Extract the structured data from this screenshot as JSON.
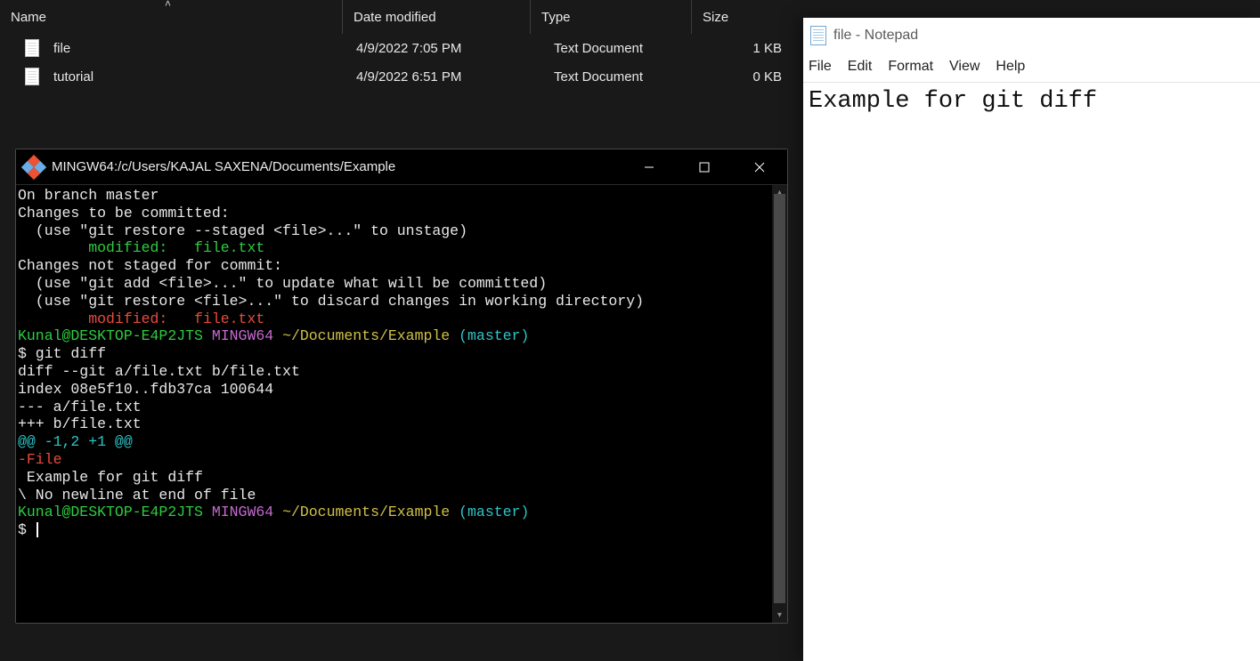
{
  "explorer": {
    "columns": {
      "name": "Name",
      "date": "Date modified",
      "type": "Type",
      "size": "Size"
    },
    "sort_indicator": "˄",
    "rows": [
      {
        "name": "file",
        "date": "4/9/2022 7:05 PM",
        "type": "Text Document",
        "size": "1 KB"
      },
      {
        "name": "tutorial",
        "date": "4/9/2022 6:51 PM",
        "type": "Text Document",
        "size": "0 KB"
      }
    ]
  },
  "terminal": {
    "title": "MINGW64:/c/Users/KAJAL SAXENA/Documents/Example",
    "lines": [
      {
        "segments": [
          {
            "t": "On branch master",
            "c": "wht"
          }
        ]
      },
      {
        "segments": [
          {
            "t": "Changes to be committed:",
            "c": "wht"
          }
        ]
      },
      {
        "segments": [
          {
            "t": "  (use \"git restore --staged <file>...\" to unstage)",
            "c": "wht"
          }
        ]
      },
      {
        "segments": [
          {
            "t": "        ",
            "c": "wht"
          },
          {
            "t": "modified:   file.txt",
            "c": "grn"
          }
        ]
      },
      {
        "segments": [
          {
            "t": "",
            "c": "wht"
          }
        ]
      },
      {
        "segments": [
          {
            "t": "Changes not staged for commit:",
            "c": "wht"
          }
        ]
      },
      {
        "segments": [
          {
            "t": "  (use \"git add <file>...\" to update what will be committed)",
            "c": "wht"
          }
        ]
      },
      {
        "segments": [
          {
            "t": "  (use \"git restore <file>...\" to discard changes in working directory)",
            "c": "wht"
          }
        ]
      },
      {
        "segments": [
          {
            "t": "        ",
            "c": "wht"
          },
          {
            "t": "modified:   file.txt",
            "c": "red"
          }
        ]
      },
      {
        "segments": [
          {
            "t": "",
            "c": "wht"
          }
        ]
      },
      {
        "segments": [
          {
            "t": "",
            "c": "wht"
          }
        ]
      },
      {
        "segments": [
          {
            "t": "Kunal@DESKTOP-E4P2JTS",
            "c": "grn"
          },
          {
            "t": " ",
            "c": "wht"
          },
          {
            "t": "MINGW64",
            "c": "mag"
          },
          {
            "t": " ",
            "c": "wht"
          },
          {
            "t": "~/Documents/Example",
            "c": "yel"
          },
          {
            "t": " ",
            "c": "wht"
          },
          {
            "t": "(master)",
            "c": "cyn"
          }
        ]
      },
      {
        "segments": [
          {
            "t": "$ git diff",
            "c": "wht"
          }
        ]
      },
      {
        "segments": [
          {
            "t": "diff --git a/file.txt b/file.txt",
            "c": "wht"
          }
        ]
      },
      {
        "segments": [
          {
            "t": "index 08e5f10..fdb37ca 100644",
            "c": "wht"
          }
        ]
      },
      {
        "segments": [
          {
            "t": "--- a/file.txt",
            "c": "wht"
          }
        ]
      },
      {
        "segments": [
          {
            "t": "+++ b/file.txt",
            "c": "wht"
          }
        ]
      },
      {
        "segments": [
          {
            "t": "@@ -1,2 +1 @@",
            "c": "cyn"
          }
        ]
      },
      {
        "segments": [
          {
            "t": "-File",
            "c": "red"
          }
        ]
      },
      {
        "segments": [
          {
            "t": " Example for git diff",
            "c": "wht"
          }
        ]
      },
      {
        "segments": [
          {
            "t": "\\ No newline at end of file",
            "c": "wht"
          }
        ]
      },
      {
        "segments": [
          {
            "t": "",
            "c": "wht"
          }
        ]
      },
      {
        "segments": [
          {
            "t": "Kunal@DESKTOP-E4P2JTS",
            "c": "grn"
          },
          {
            "t": " ",
            "c": "wht"
          },
          {
            "t": "MINGW64",
            "c": "mag"
          },
          {
            "t": " ",
            "c": "wht"
          },
          {
            "t": "~/Documents/Example",
            "c": "yel"
          },
          {
            "t": " ",
            "c": "wht"
          },
          {
            "t": "(master)",
            "c": "cyn"
          }
        ]
      },
      {
        "segments": [
          {
            "t": "$ ",
            "c": "wht"
          }
        ],
        "cursor": true
      }
    ]
  },
  "notepad": {
    "title": "file - Notepad",
    "menu": [
      "File",
      "Edit",
      "Format",
      "View",
      "Help"
    ],
    "content": "Example for git diff"
  }
}
